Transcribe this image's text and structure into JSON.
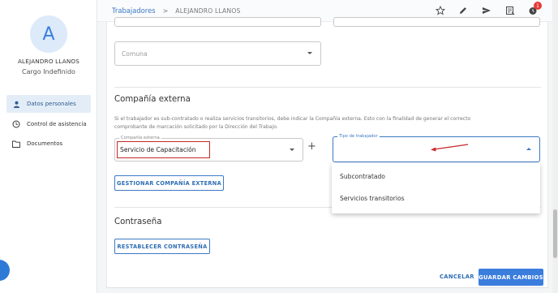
{
  "sidebar": {
    "avatar_letter": "A",
    "user_name": "ALEJANDRO LLANOS",
    "user_role": "Cargo Indefinido",
    "items": [
      {
        "label": "Datos personales",
        "icon": "person-icon",
        "active": true
      },
      {
        "label": "Control de asistencia",
        "icon": "clock-icon",
        "active": false
      },
      {
        "label": "Documentos",
        "icon": "folder-icon",
        "active": false
      }
    ]
  },
  "topbar": {
    "breadcrumb_link": "Trabajadores",
    "breadcrumb_sep": ">",
    "breadcrumb_current": "ALEJANDRO LLANOS",
    "notification_count": "1",
    "icons": [
      "star-icon",
      "edit-icon",
      "send-icon",
      "export-icon",
      "notification-icon"
    ]
  },
  "form": {
    "comuna_placeholder": "Comuna",
    "company_section_title": "Compañía externa",
    "company_help_line1": "Si el trabajador es sub-contratado o realiza servicios transitorios, debe indicar la Compañía externa. Esto con la finalidad de generar el correcto",
    "company_help_line2": "comprobante de marcación solicitado por la Dirección del Trabajo.",
    "company_label": "Compañía externa",
    "company_value": "Servicio de Capacitación",
    "worker_type_label": "Tipo de trabajador",
    "worker_type_options": [
      "Subcontratado",
      "Servicios transitorios"
    ],
    "manage_company_button": "GESTIONAR COMPAÑÍA EXTERNA",
    "password_section_title": "Contraseña",
    "reset_password_button": "RESTABLECER CONTRASEÑA",
    "cancel_button": "CANCELAR",
    "save_button": "GUARDAR CAMBIOS"
  },
  "colors": {
    "accent": "#3b7ddd",
    "highlight_box": "#c62828",
    "badge": "#e53935"
  }
}
